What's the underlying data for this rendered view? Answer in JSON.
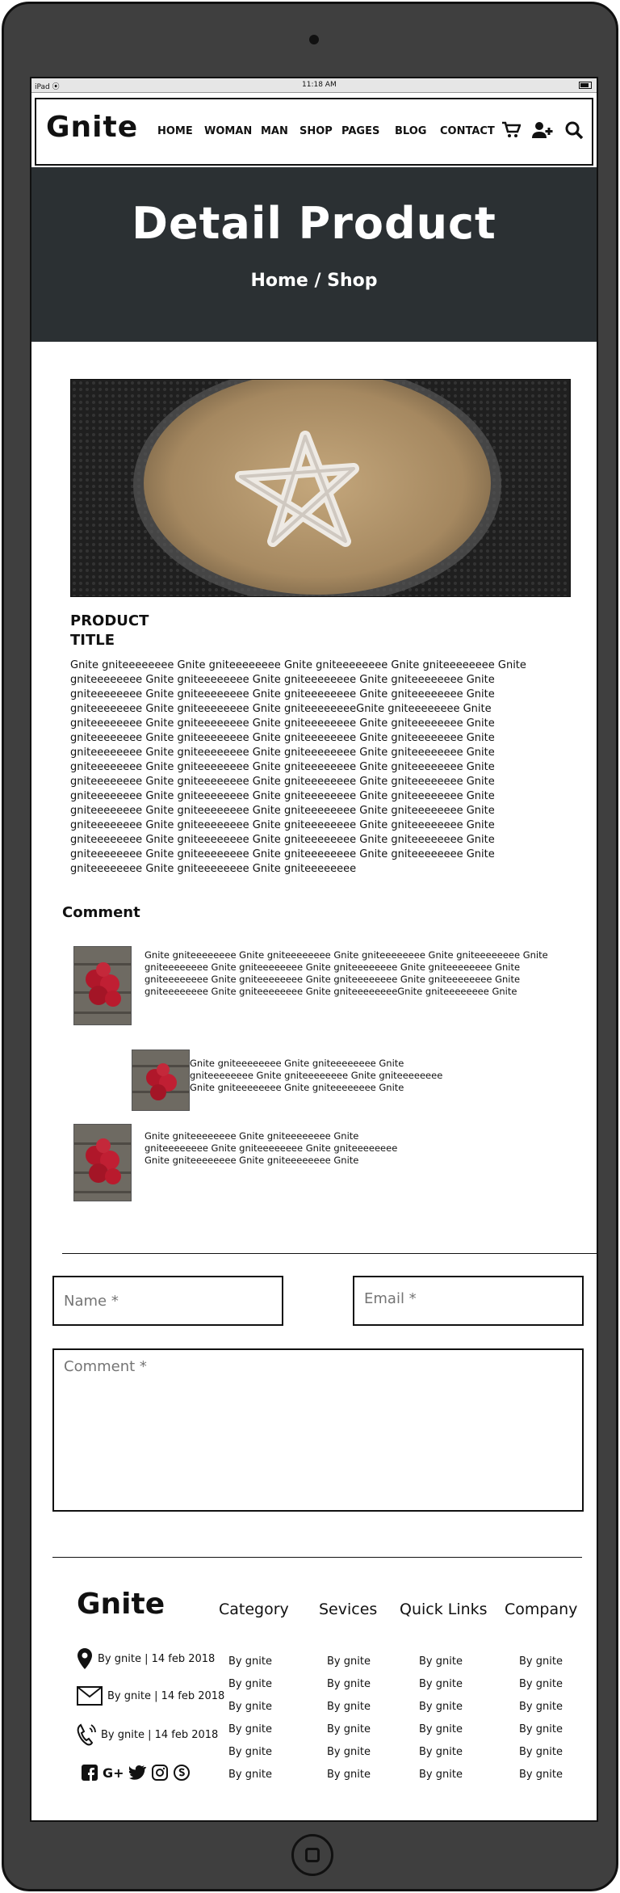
{
  "status_bar": {
    "device": "iPad",
    "time": "11:18 AM"
  },
  "brand": {
    "logo": "Gnite"
  },
  "nav": {
    "items": [
      "HOME",
      "WOMAN",
      "MAN",
      "SHOP",
      "PAGES",
      "BLOG",
      "CONTACT"
    ],
    "icons": [
      "cart-icon",
      "add-user-icon",
      "search-icon"
    ]
  },
  "hero": {
    "title": "Detail Product",
    "breadcrumb": "Home / Shop"
  },
  "product": {
    "title": "PRODUCT TITLE",
    "description": "Gnite gniteeeeeeee Gnite gniteeeeeeee Gnite gniteeeeeeee Gnite gniteeeeeeee Gnite gniteeeeeeee  Gnite gniteeeeeeee Gnite gniteeeeeeee Gnite gniteeeeeeee Gnite gniteeeeeeee Gnite gniteeeeeeee  Gnite gniteeeeeeee Gnite gniteeeeeeee Gnite gniteeeeeeee Gnite gniteeeeeeee Gnite gniteeeeeeeeGnite gniteeeeeeee Gnite gniteeeeeeee Gnite gniteeeeeeee Gnite gniteeeeeeee Gnite gniteeeeeeee  Gnite gniteeeeeeee Gnite gniteeeeeeee Gnite gniteeeeeeee Gnite gniteeeeeeee Gnite gniteeeeeeee  Gnite gniteeeeeeee Gnite gniteeeeeeee Gnite gniteeeeeeee Gnite gniteeeeeeee Gnite gniteeeeeeee Gnite gniteeeeeeee Gnite gniteeeeeeee Gnite gniteeeeeeee Gnite gniteeeeeeee Gnite gniteeeeeeee Gnite gniteeeeeeee  Gnite gniteeeeeeee Gnite gniteeeeeeee Gnite gniteeeeeeee Gnite gniteeeeeeee Gnite gniteeeeeeee Gnite gniteeeeeeee Gnite gniteeeeeeee Gnite gniteeeeeeee Gnite gniteeeeeeee Gnite gniteeeeeeee Gnite gniteeeeeeee Gnite gniteeeeeeee Gnite gniteeeeeeee Gnite gniteeeeeeee  Gnite gniteeeeeeee Gnite gniteeeeeeee Gnite gniteeeeeeee Gnite gniteeeeeeee  Gnite gniteeeeeeee Gnite gniteeeeeeee Gnite gniteeeeeeee Gnite gniteeeeeeee Gnite gniteeeeeeee"
  },
  "comments": {
    "heading": "Comment",
    "items": [
      {
        "text": "Gnite gniteeeeeeee Gnite gniteeeeeeee Gnite gniteeeeeeee Gnite gniteeeeeeee Gnite gniteeeeeeee  Gnite gniteeeeeeee Gnite gniteeeeeeee Gnite gniteeeeeeee Gnite gniteeeeeeee Gnite gniteeeeeeee  Gnite gniteeeeeeee Gnite gniteeeeeeee Gnite gniteeeeeeee Gnite gniteeeeeeee Gnite gniteeeeeeeeGnite gniteeeeeeee Gnite"
      },
      {
        "text": "Gnite gniteeeeeeee Gnite gniteeeeeeee Gnite gniteeeeeeee Gnite gniteeeeeeee Gnite gniteeeeeeee Gnite gniteeeeeeee Gnite gniteeeeeeee Gnite"
      },
      {
        "text": "Gnite gniteeeeeeee Gnite gniteeeeeeee Gnite gniteeeeeeee Gnite gniteeeeeeee Gnite gniteeeeeeee Gnite gniteeeeeeee Gnite gniteeeeeeee Gnite"
      }
    ]
  },
  "form": {
    "name_placeholder": "Name *",
    "email_placeholder": "Email *",
    "comment_placeholder": "Comment *"
  },
  "footer": {
    "logo": "Gnite",
    "contact": [
      {
        "icon": "location-icon",
        "text": "By gnite | 14 feb 2018"
      },
      {
        "icon": "mail-icon",
        "text": "By gnite | 14 feb 2018"
      },
      {
        "icon": "phone-icon",
        "text": "By gnite | 14 feb 2018"
      }
    ],
    "social": [
      "facebook-icon",
      "G+",
      "twitter-icon",
      "instagram-icon",
      "skype-icon"
    ],
    "columns": [
      {
        "heading": "Category",
        "items": [
          "By gnite",
          "By gnite",
          "By gnite",
          "By gnite",
          "By gnite",
          "By gnite"
        ]
      },
      {
        "heading": "Sevices",
        "items": [
          "By gnite",
          "By gnite",
          "By gnite",
          "By gnite",
          "By gnite",
          "By gnite"
        ]
      },
      {
        "heading": "Quick Links",
        "items": [
          "By gnite",
          "By gnite",
          "By gnite",
          "By gnite",
          "By gnite",
          "By gnite"
        ]
      },
      {
        "heading": "Company",
        "items": [
          "By gnite",
          "By gnite",
          "By gnite",
          "By gnite",
          "By gnite",
          "By gnite"
        ]
      }
    ]
  }
}
